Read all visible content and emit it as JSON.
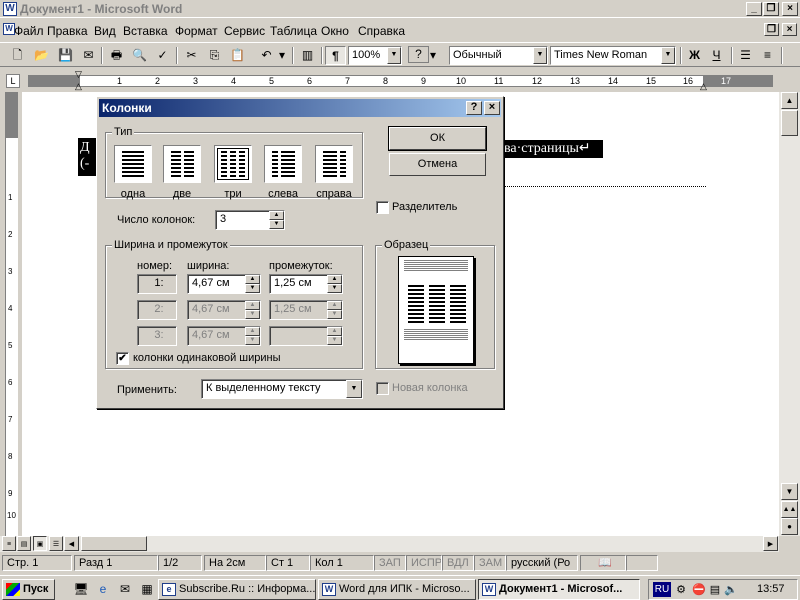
{
  "window": {
    "title": "Документ1 - Microsoft Word",
    "app_icon": "W"
  },
  "menu": [
    "Файл",
    "Правка",
    "Вид",
    "Вставка",
    "Формат",
    "Сервис",
    "Таблица",
    "Окно",
    "Справка"
  ],
  "toolbar": {
    "zoom": "100%",
    "style": "Обычный",
    "font": "Times New Roman",
    "bold": "Ж",
    "underline": "Ч",
    "pilcrow": "¶"
  },
  "ruler": {
    "numbers": [
      "1",
      "2",
      "3",
      "4",
      "5",
      "6",
      "7",
      "8",
      "9",
      "10",
      "11",
      "12",
      "13",
      "14",
      "15",
      "16",
      "17"
    ]
  },
  "vruler": {
    "numbers": [
      "1",
      "2",
      "3",
      "4",
      "5",
      "6",
      "7",
      "8",
      "9",
      "10"
    ]
  },
  "document": {
    "text_left": "Д",
    "text_left2": "(-",
    "text_right": "ва·страницы↵"
  },
  "dialog": {
    "title": "Колонки",
    "help": "?",
    "close": "×",
    "type_group": "Тип",
    "presets": [
      "одна",
      "две",
      "три",
      "слева",
      "справа"
    ],
    "ok": "ОК",
    "cancel": "Отмена",
    "separator_label": "Разделитель",
    "num_columns_label": "Число колонок:",
    "num_columns": "3",
    "width_group": "Ширина и промежуток",
    "col_number_header": "номер:",
    "col_width_header": "ширина:",
    "col_spacing_header": "промежуток:",
    "rows": [
      {
        "num": "1:",
        "width": "4,67 см",
        "spacing": "1,25 см"
      },
      {
        "num": "2:",
        "width": "4,67 см",
        "spacing": "1,25 см"
      },
      {
        "num": "3:",
        "width": "4,67 см",
        "spacing": ""
      }
    ],
    "equal_width_label": "колонки одинаковой ширины",
    "equal_width_checked": "✔",
    "sample_group": "Образец",
    "apply_label": "Применить:",
    "apply_value": "К выделенному тексту",
    "new_column_label": "Новая колонка"
  },
  "statusbar": {
    "page": "Стр. 1",
    "section": "Разд 1",
    "pages": "1/2",
    "at": "На 2см",
    "line": "Ст 1",
    "col": "Кол 1",
    "rec": "ЗАП",
    "trk": "ИСПР",
    "ext": "ВДЛ",
    "ovr": "ЗАМ",
    "lang": "русский (Ро"
  },
  "taskbar": {
    "start": "Пуск",
    "tasks": [
      "Subscribe.Ru :: Информа...",
      "Word для ИПК - Microso...",
      "Документ1 - Microsof..."
    ],
    "lang": "RU",
    "time": "13:57"
  }
}
